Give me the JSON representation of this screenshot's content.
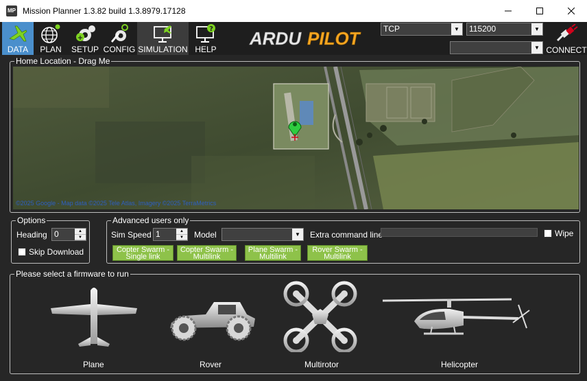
{
  "window": {
    "title": "Mission Planner 1.3.82 build 1.3.8979.17128",
    "icon_text": "MP",
    "controls": [
      "minimize-icon",
      "maximize-icon",
      "close-icon"
    ]
  },
  "toolbar": {
    "items": [
      {
        "label": "DATA",
        "icon": "airplane-icon",
        "active": true
      },
      {
        "label": "PLAN",
        "icon": "globe-icon"
      },
      {
        "label": "SETUP",
        "icon": "gears-plus-icon"
      },
      {
        "label": "CONFIG",
        "icon": "wrench-gear-icon"
      },
      {
        "label": "SIMULATION",
        "icon": "monitor-plane-icon"
      },
      {
        "label": "HELP",
        "icon": "monitor-question-icon"
      }
    ],
    "logo_text": "ARDUPILOT",
    "logo_part1": "ARDU",
    "logo_part2": "PILOT"
  },
  "connection": {
    "port_value": "TCP",
    "baud_value": "115200",
    "link_value": "",
    "connect_label": "CONNECT"
  },
  "home_location": {
    "title": "Home Location - Drag Me",
    "map_copyright": "©2025 Google - Map data ©2025 Tele Atlas, Imagery ©2025 TerraMetrics"
  },
  "options": {
    "title": "Options",
    "heading_label": "Heading",
    "heading_value": "0",
    "skip_download_label": "Skip Download",
    "skip_download_checked": false
  },
  "advanced": {
    "title": "Advanced users only",
    "sim_speed_label": "Sim Speed",
    "sim_speed_value": "1",
    "model_label": "Model",
    "model_value": "",
    "extra_cmd_label": "Extra command line",
    "extra_cmd_value": "",
    "wipe_label": "Wipe",
    "wipe_checked": false,
    "swarm_buttons": [
      {
        "line1": "Copter Swarm -",
        "line2": "Single link"
      },
      {
        "line1": "Copter Swarm -",
        "line2": "Multilink"
      },
      {
        "line1": "Plane Swarm -",
        "line2": "Multilink"
      },
      {
        "line1": "Rover Swarm -",
        "line2": "Multilink"
      }
    ]
  },
  "firmware": {
    "title": "Please select a firmware to run",
    "items": [
      {
        "label": "Plane",
        "icon": "plane-icon"
      },
      {
        "label": "Rover",
        "icon": "rover-icon"
      },
      {
        "label": "Multirotor",
        "icon": "multirotor-icon"
      },
      {
        "label": "Helicopter",
        "icon": "helicopter-icon"
      }
    ]
  },
  "colors": {
    "background": "#262626",
    "active_tab": "#4a8fcc",
    "swarm_button": "#8ec24a",
    "logo_accent": "#f5a623"
  }
}
